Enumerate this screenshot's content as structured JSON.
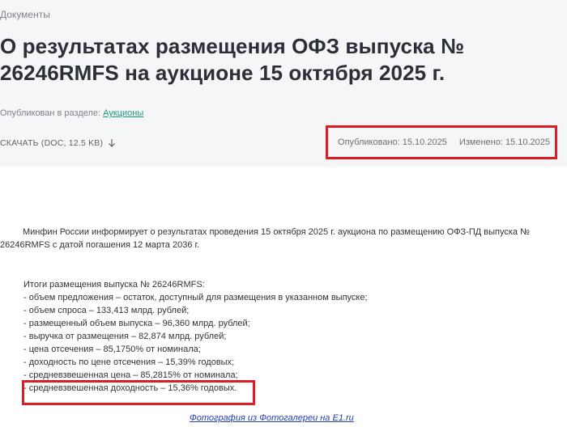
{
  "breadcrumb": "Документы",
  "title_line1": "О результатах размещения ОФЗ выпуска №",
  "title_line2": "26246RMFS на аукционе 15 октября 2025 г.",
  "published_in_label": "Опубликован в разделе:",
  "published_in_link": "Аукционы",
  "download_label": "СКАЧАТЬ (DOC, 12.5 KB)",
  "published_date": "Опубликовано: 15.10.2025",
  "modified_date": "Изменено: 15.10.2025",
  "intro_line1": "Минфин России информирует о результатах проведения 15 октября 2025 г. аукциона по размещению ОФЗ-ПД выпуска №",
  "intro_line2": "26246RMFS с датой погашения 12 марта 2036 г.",
  "results_heading": "Итоги размещения выпуска № 26246RMFS:",
  "results": [
    "- объем предложения – остаток, доступный для размещения в указанном выпуске;",
    "- объем спроса – 133,413 млрд. рублей;",
    "- размещенный объем выпуска – 96,360 млрд. рублей;",
    "- выручка от размещения – 82,874 млрд. рублей;",
    "- цена отсечения – 85,1750% от номинала;",
    "- доходность по цене отсечения – 15,39% годовых;",
    "- средневзвешенная цена – 85,2815% от номинала;",
    "- средневзвешенная доходность – 15,36% годовых."
  ],
  "photo_credit": "Фотография из Фотогалереи на E1.ru",
  "colors": {
    "highlight": "#e01b24",
    "link_green": "#1a9a7a",
    "header_bg": "#f5f6f8"
  }
}
